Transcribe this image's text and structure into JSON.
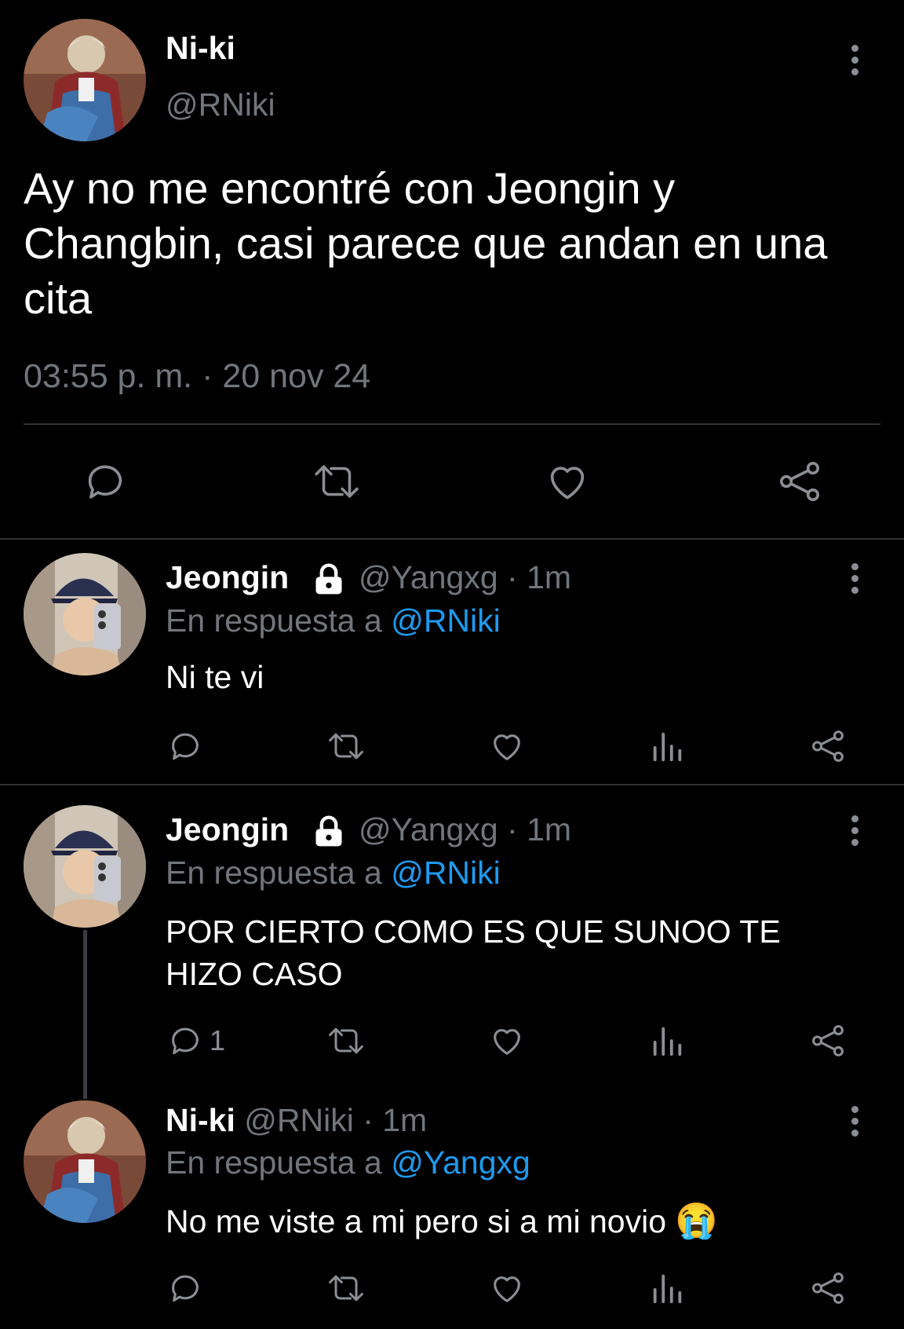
{
  "main_tweet": {
    "display_name": "Ni-ki",
    "handle": "@RNiki",
    "text": "Ay no me encontré con Jeongin y Changbin, casi parece que andan en una cita",
    "timestamp": "03:55 p. m. · 20 nov 24"
  },
  "replies": [
    {
      "display_name": "Jeongin",
      "handle_time": "@Yangxg · 1m",
      "reply_prefix": "En respuesta a",
      "reply_to": "@RNiki",
      "text": "Ni te vi",
      "reply_count": ""
    },
    {
      "display_name": "Jeongin",
      "handle_time": "@Yangxg · 1m",
      "reply_prefix": "En respuesta a",
      "reply_to": "@RNiki",
      "text": "POR CIERTO COMO ES QUE SUNOO TE HIZO CASO",
      "reply_count": "1"
    },
    {
      "display_name": "Ni-ki",
      "handle_time": "@RNiki · 1m",
      "reply_prefix": "En respuesta a",
      "reply_to": "@Yangxg",
      "text": "No me viste a mi pero si a mi novio",
      "emoji": "😭",
      "reply_count": ""
    }
  ],
  "icons": {
    "reply": "reply-icon",
    "retweet": "retweet-icon",
    "like": "like-icon",
    "views": "views-icon",
    "share": "share-icon",
    "more": "more-icon",
    "lock": "lock-icon"
  },
  "colors": {
    "background": "#000000",
    "text": "#e7e9ea",
    "muted": "#71767b",
    "link": "#1d9bf0"
  }
}
